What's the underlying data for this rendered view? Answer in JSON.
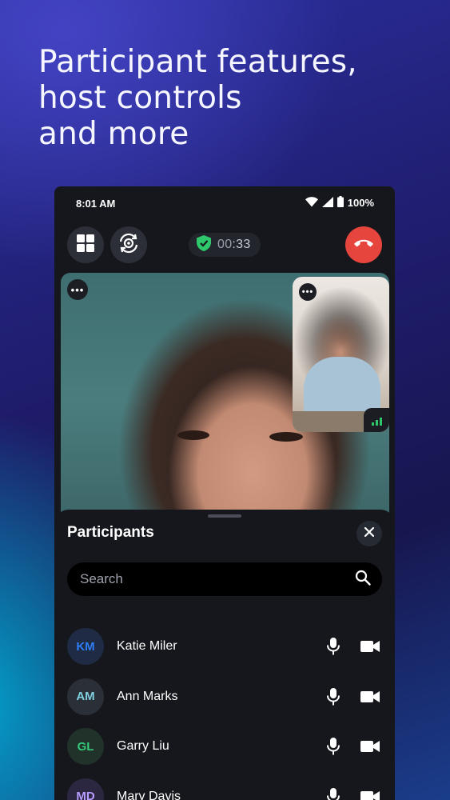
{
  "headline": {
    "line1": "Participant features,",
    "line2": "host controls",
    "line3": "and more"
  },
  "status_bar": {
    "time": "8:01 AM",
    "battery": "100%",
    "icons": [
      "wifi-icon",
      "cell-signal-icon",
      "battery-icon"
    ]
  },
  "call": {
    "timer_minutes": "00",
    "timer_seconds": ":33",
    "icons": [
      "grid-view-icon",
      "rotate-camera-icon",
      "shield-check-icon",
      "end-call-icon"
    ],
    "colors": {
      "end_call": "#e5453d",
      "secure": "#2fc76b"
    }
  },
  "video": {
    "main_menu": "•••",
    "pip_menu": "•••"
  },
  "participants_panel": {
    "title": "Participants",
    "search_placeholder": "Search",
    "participants": [
      {
        "initials": "KM",
        "name": "Katie Miler",
        "initials_color": "#2f7df6",
        "avatar_bg": "#1f2b45"
      },
      {
        "initials": "AM",
        "name": "Ann Marks",
        "initials_color": "#7fd0e0",
        "avatar_bg": "#2b3038"
      },
      {
        "initials": "GL",
        "name": "Garry Liu",
        "initials_color": "#35c77a",
        "avatar_bg": "#203229"
      },
      {
        "initials": "MD",
        "name": "Mary Davis",
        "initials_color": "#b89cff",
        "avatar_bg": "#2c2740"
      }
    ]
  }
}
